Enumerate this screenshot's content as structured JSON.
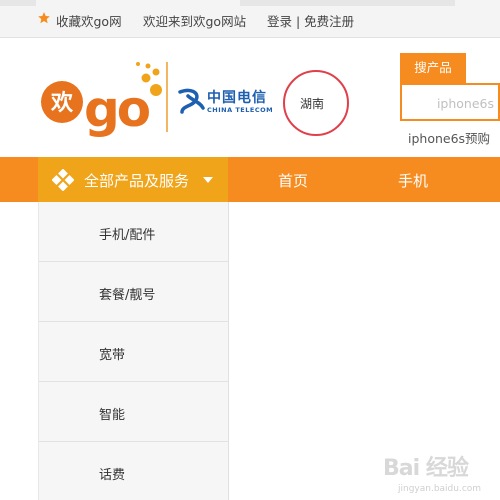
{
  "topbar": {
    "favorite": "收藏欢go网",
    "welcome": "欢迎来到欢go网站",
    "auth": "登录 | 免费注册"
  },
  "brand": {
    "logo_text": "欢go",
    "telecom_cn": "中国电信",
    "telecom_en": "CHINA TELECOM"
  },
  "region": {
    "current": "湖南"
  },
  "search": {
    "button_label": "搜产品",
    "placeholder": "iphone6s",
    "hot_link": "iphone6s预购"
  },
  "nav": {
    "all_products": "全部产品及服务",
    "links": [
      "首页",
      "手机"
    ]
  },
  "sidebar": {
    "items": [
      {
        "label": "手机/配件"
      },
      {
        "label": "套餐/靓号"
      },
      {
        "label": "宽带"
      },
      {
        "label": "智能"
      },
      {
        "label": "话费"
      }
    ]
  },
  "watermark": {
    "text": "Bai 经验",
    "sub": "jingyan.baidu.com"
  },
  "colors": {
    "accent": "#f68b1f",
    "menu_highlight": "#f0a41a",
    "telecom_blue": "#1d5fb0",
    "annotation_red": "#e0404a"
  }
}
